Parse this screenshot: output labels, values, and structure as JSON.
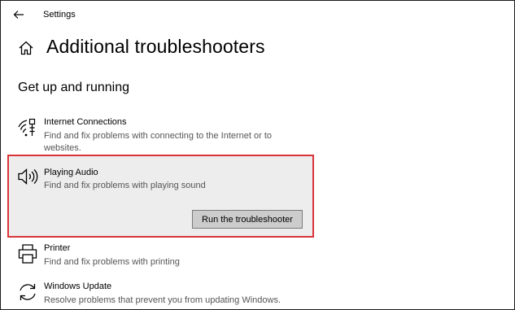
{
  "window": {
    "title": "Settings"
  },
  "page": {
    "title": "Additional troubleshooters"
  },
  "section": {
    "title": "Get up and running"
  },
  "items": [
    {
      "name": "Internet Connections",
      "description": "Find and fix problems with connecting to the Internet or to websites.",
      "icon": "wifi-icon"
    },
    {
      "name": "Playing Audio",
      "description": "Find and fix problems with playing sound",
      "icon": "speaker-icon",
      "selected": true,
      "action_label": "Run the troubleshooter"
    },
    {
      "name": "Printer",
      "description": "Find and fix problems with printing",
      "icon": "printer-icon"
    },
    {
      "name": "Windows Update",
      "description": "Resolve problems that prevent you from updating Windows.",
      "icon": "update-icon"
    }
  ],
  "colors": {
    "highlight_border": "#d9343a",
    "selected_background": "#ededed",
    "button_background": "#cccccc"
  }
}
